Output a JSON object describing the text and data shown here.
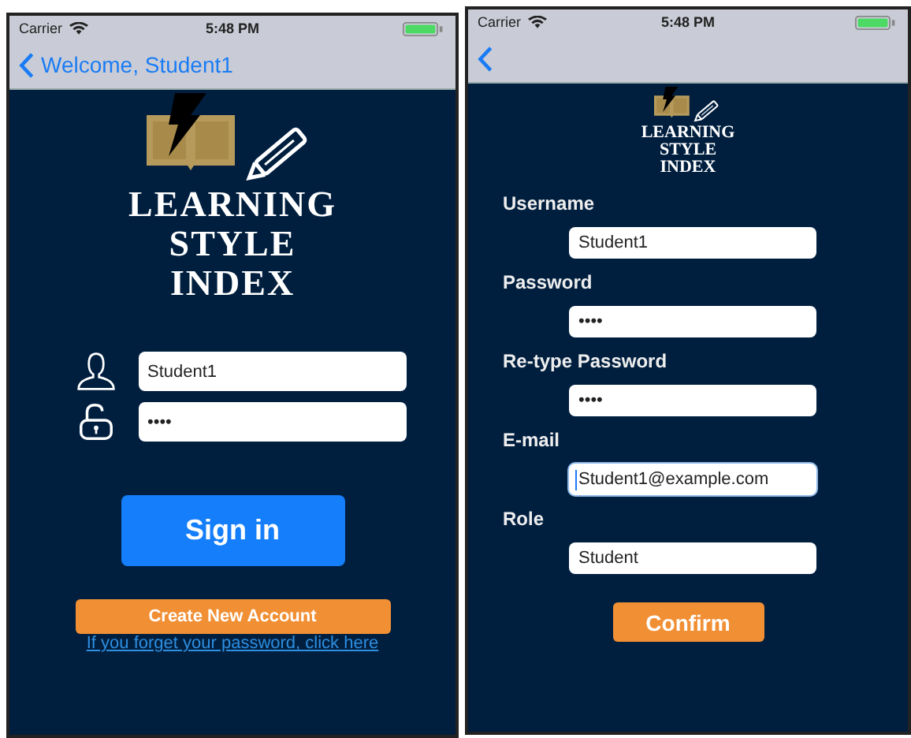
{
  "screens": [
    {
      "kind": "login",
      "status_bar": {
        "carrier": "Carrier",
        "time": "5:48 PM"
      },
      "nav": {
        "back_label": "Welcome, Student1"
      },
      "logo": [
        "LEARNING",
        "STYLE",
        "INDEX"
      ],
      "fields": [
        {
          "kind": "user",
          "value": "Student1"
        },
        {
          "kind": "lock",
          "value": "••••"
        }
      ],
      "sign_in": "Sign in",
      "create_account": "Create New Account",
      "forgot_link": "If you forget your password, click here"
    },
    {
      "kind": "register",
      "status_bar": {
        "carrier": "Carrier",
        "time": "5:48 PM"
      },
      "logo": [
        "LEARNING",
        "STYLE",
        "INDEX"
      ],
      "fields": [
        {
          "label": "Username",
          "value": "Student1",
          "focused": false
        },
        {
          "label": "Password",
          "value": "••••",
          "focused": false
        },
        {
          "label": "Re-type Password",
          "value": "••••",
          "focused": false
        },
        {
          "label": "E-mail",
          "value": "Student1@example.com",
          "focused": true
        },
        {
          "label": "Role",
          "value": "Student",
          "focused": false
        }
      ],
      "confirm": "Confirm"
    }
  ]
}
